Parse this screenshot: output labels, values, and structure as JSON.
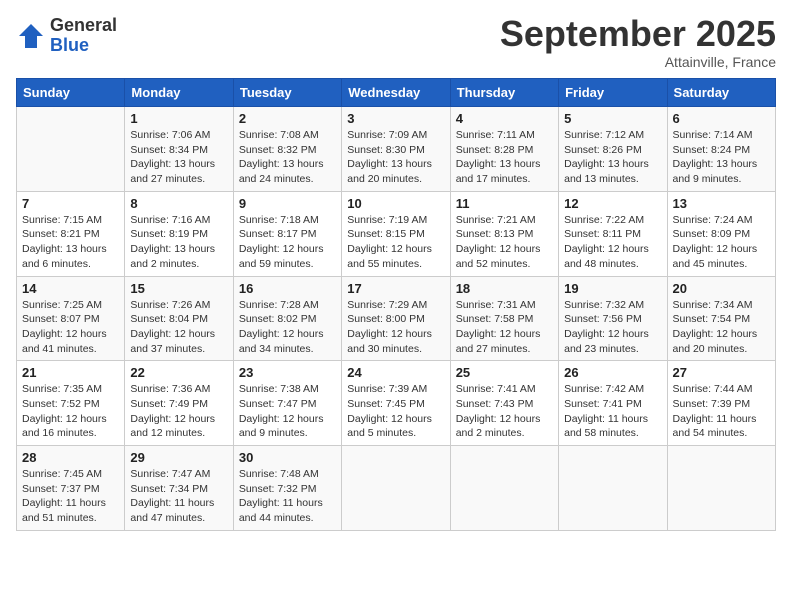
{
  "logo": {
    "general": "General",
    "blue": "Blue"
  },
  "title": "September 2025",
  "location": "Attainville, France",
  "days_header": [
    "Sunday",
    "Monday",
    "Tuesday",
    "Wednesday",
    "Thursday",
    "Friday",
    "Saturday"
  ],
  "weeks": [
    [
      {
        "day": "",
        "info": ""
      },
      {
        "day": "1",
        "info": "Sunrise: 7:06 AM\nSunset: 8:34 PM\nDaylight: 13 hours\nand 27 minutes."
      },
      {
        "day": "2",
        "info": "Sunrise: 7:08 AM\nSunset: 8:32 PM\nDaylight: 13 hours\nand 24 minutes."
      },
      {
        "day": "3",
        "info": "Sunrise: 7:09 AM\nSunset: 8:30 PM\nDaylight: 13 hours\nand 20 minutes."
      },
      {
        "day": "4",
        "info": "Sunrise: 7:11 AM\nSunset: 8:28 PM\nDaylight: 13 hours\nand 17 minutes."
      },
      {
        "day": "5",
        "info": "Sunrise: 7:12 AM\nSunset: 8:26 PM\nDaylight: 13 hours\nand 13 minutes."
      },
      {
        "day": "6",
        "info": "Sunrise: 7:14 AM\nSunset: 8:24 PM\nDaylight: 13 hours\nand 9 minutes."
      }
    ],
    [
      {
        "day": "7",
        "info": "Sunrise: 7:15 AM\nSunset: 8:21 PM\nDaylight: 13 hours\nand 6 minutes."
      },
      {
        "day": "8",
        "info": "Sunrise: 7:16 AM\nSunset: 8:19 PM\nDaylight: 13 hours\nand 2 minutes."
      },
      {
        "day": "9",
        "info": "Sunrise: 7:18 AM\nSunset: 8:17 PM\nDaylight: 12 hours\nand 59 minutes."
      },
      {
        "day": "10",
        "info": "Sunrise: 7:19 AM\nSunset: 8:15 PM\nDaylight: 12 hours\nand 55 minutes."
      },
      {
        "day": "11",
        "info": "Sunrise: 7:21 AM\nSunset: 8:13 PM\nDaylight: 12 hours\nand 52 minutes."
      },
      {
        "day": "12",
        "info": "Sunrise: 7:22 AM\nSunset: 8:11 PM\nDaylight: 12 hours\nand 48 minutes."
      },
      {
        "day": "13",
        "info": "Sunrise: 7:24 AM\nSunset: 8:09 PM\nDaylight: 12 hours\nand 45 minutes."
      }
    ],
    [
      {
        "day": "14",
        "info": "Sunrise: 7:25 AM\nSunset: 8:07 PM\nDaylight: 12 hours\nand 41 minutes."
      },
      {
        "day": "15",
        "info": "Sunrise: 7:26 AM\nSunset: 8:04 PM\nDaylight: 12 hours\nand 37 minutes."
      },
      {
        "day": "16",
        "info": "Sunrise: 7:28 AM\nSunset: 8:02 PM\nDaylight: 12 hours\nand 34 minutes."
      },
      {
        "day": "17",
        "info": "Sunrise: 7:29 AM\nSunset: 8:00 PM\nDaylight: 12 hours\nand 30 minutes."
      },
      {
        "day": "18",
        "info": "Sunrise: 7:31 AM\nSunset: 7:58 PM\nDaylight: 12 hours\nand 27 minutes."
      },
      {
        "day": "19",
        "info": "Sunrise: 7:32 AM\nSunset: 7:56 PM\nDaylight: 12 hours\nand 23 minutes."
      },
      {
        "day": "20",
        "info": "Sunrise: 7:34 AM\nSunset: 7:54 PM\nDaylight: 12 hours\nand 20 minutes."
      }
    ],
    [
      {
        "day": "21",
        "info": "Sunrise: 7:35 AM\nSunset: 7:52 PM\nDaylight: 12 hours\nand 16 minutes."
      },
      {
        "day": "22",
        "info": "Sunrise: 7:36 AM\nSunset: 7:49 PM\nDaylight: 12 hours\nand 12 minutes."
      },
      {
        "day": "23",
        "info": "Sunrise: 7:38 AM\nSunset: 7:47 PM\nDaylight: 12 hours\nand 9 minutes."
      },
      {
        "day": "24",
        "info": "Sunrise: 7:39 AM\nSunset: 7:45 PM\nDaylight: 12 hours\nand 5 minutes."
      },
      {
        "day": "25",
        "info": "Sunrise: 7:41 AM\nSunset: 7:43 PM\nDaylight: 12 hours\nand 2 minutes."
      },
      {
        "day": "26",
        "info": "Sunrise: 7:42 AM\nSunset: 7:41 PM\nDaylight: 11 hours\nand 58 minutes."
      },
      {
        "day": "27",
        "info": "Sunrise: 7:44 AM\nSunset: 7:39 PM\nDaylight: 11 hours\nand 54 minutes."
      }
    ],
    [
      {
        "day": "28",
        "info": "Sunrise: 7:45 AM\nSunset: 7:37 PM\nDaylight: 11 hours\nand 51 minutes."
      },
      {
        "day": "29",
        "info": "Sunrise: 7:47 AM\nSunset: 7:34 PM\nDaylight: 11 hours\nand 47 minutes."
      },
      {
        "day": "30",
        "info": "Sunrise: 7:48 AM\nSunset: 7:32 PM\nDaylight: 11 hours\nand 44 minutes."
      },
      {
        "day": "",
        "info": ""
      },
      {
        "day": "",
        "info": ""
      },
      {
        "day": "",
        "info": ""
      },
      {
        "day": "",
        "info": ""
      }
    ]
  ]
}
